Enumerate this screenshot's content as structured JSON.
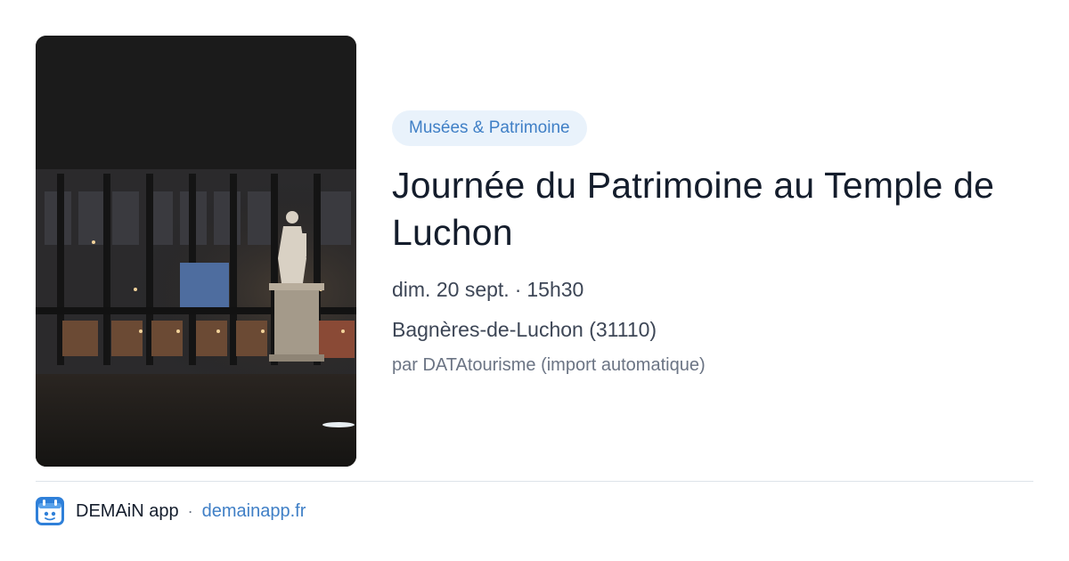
{
  "card": {
    "image_alt": "Statue illuminée devant un bâtiment la nuit",
    "category": "Musées & Patrimoine",
    "title": "Journée du Patrimoine au Temple de Luchon",
    "date": "dim. 20 sept.",
    "time": "15h30",
    "date_separator": "·",
    "location": "Bagnères-de-Luchon (31110)",
    "source": "par DATAtourisme (import automatique)"
  },
  "footer": {
    "app_name": "DEMAiN app",
    "separator": "·",
    "link": "demainapp.fr",
    "logo_icon": "demain-app-logo-icon"
  },
  "colors": {
    "chip_bg": "#e9f2fb",
    "accent": "#3f7fc6",
    "title": "#141d2c",
    "muted": "#6b7484"
  }
}
